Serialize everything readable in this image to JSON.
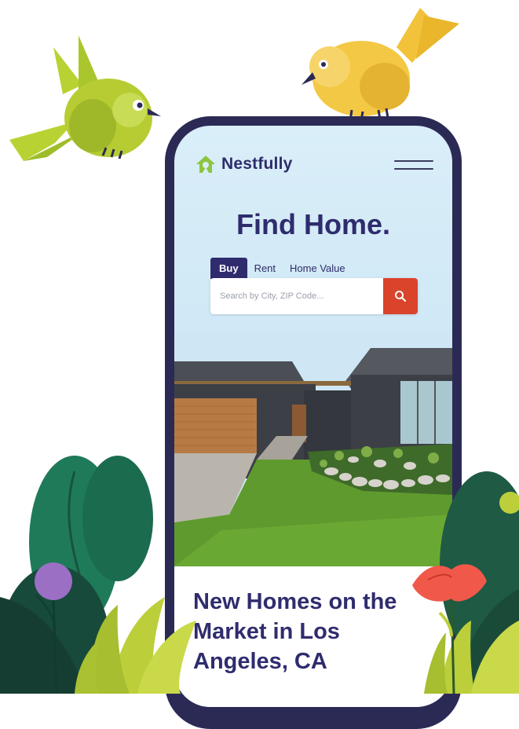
{
  "app": {
    "brand": "Nestfully"
  },
  "hero": {
    "title": "Find Home."
  },
  "tabs": [
    {
      "label": "Buy",
      "active": true
    },
    {
      "label": "Rent",
      "active": false
    },
    {
      "label": "Home Value",
      "active": false
    }
  ],
  "search": {
    "placeholder": "Search by City, ZIP Code...",
    "value": ""
  },
  "listing_section": {
    "title": "New Homes on the Market in Los Angeles, CA"
  },
  "colors": {
    "brand_navy": "#2f2c6e",
    "accent_red": "#d9442b",
    "logo_green": "#8cc63f",
    "sky": "#d9eef8"
  },
  "icons": {
    "menu": "hamburger-icon",
    "search": "search-icon",
    "logo": "house-logo-icon"
  }
}
